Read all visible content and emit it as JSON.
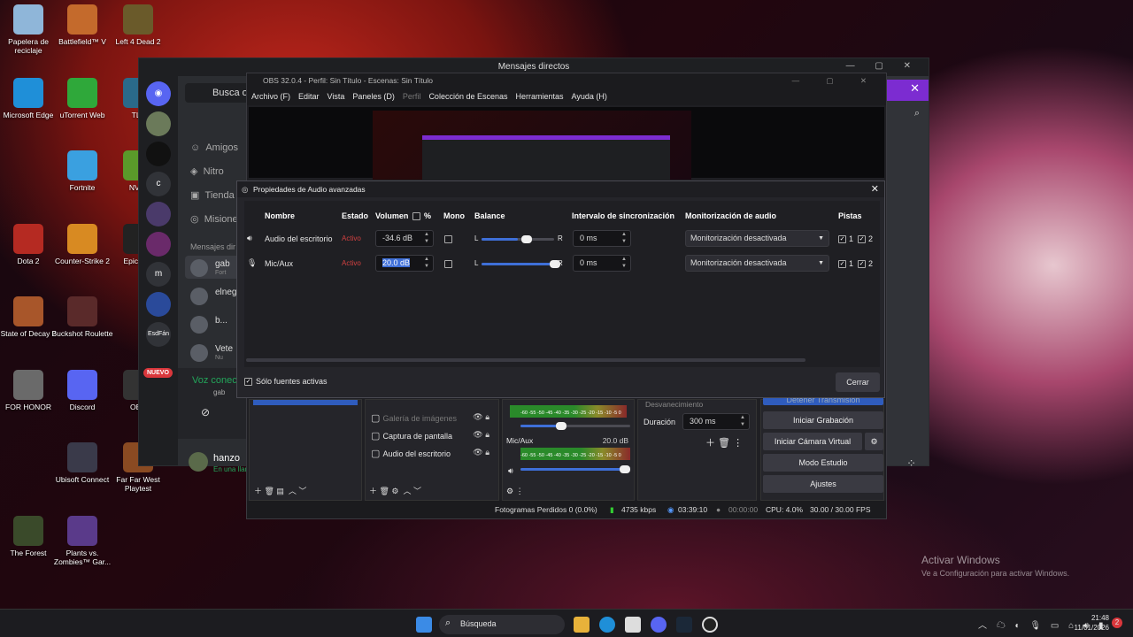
{
  "desktop_icons": [
    {
      "label": "Papelera de reciclaje",
      "color": "#8fb6d9"
    },
    {
      "label": "Battlefield™ V",
      "color": "#c46a2c"
    },
    {
      "label": "Left 4 Dead 2",
      "color": "#6a5a2a"
    },
    {
      "label": "Microsoft Edge",
      "color": "#1f8fd8"
    },
    {
      "label": "uTorrent Web",
      "color": "#2fa83a"
    },
    {
      "label": "Fortnite",
      "color": "#3aa0e0"
    },
    {
      "label": "Dota 2",
      "color": "#b52a22"
    },
    {
      "label": "Counter-Strike 2",
      "color": "#d88a22"
    },
    {
      "label": "State of Decay 2",
      "color": "#a8562a"
    },
    {
      "label": "Buckshot Roulette",
      "color": "#5a2a2a"
    },
    {
      "label": "FOR HONOR",
      "color": "#6a6a6a"
    },
    {
      "label": "Discord",
      "color": "#5865f2"
    },
    {
      "label": "Ubisoft Connect",
      "color": "#3a3a4a"
    },
    {
      "label": "Far Far West Playtest",
      "color": "#8a4a22"
    },
    {
      "label": "The Forest",
      "color": "#3a4a2a"
    },
    {
      "label": "Plants vs. Zombies™ Gar...",
      "color": "#5a3a8a"
    },
    {
      "label": "TLa",
      "color": "#2a6a8a"
    },
    {
      "label": "NVID",
      "color": "#5a9a2a"
    },
    {
      "label": "Epic Lau",
      "color": "#222"
    },
    {
      "label": "OBS",
      "color": "#333"
    }
  ],
  "discord": {
    "title": "Mensajes directos",
    "search": "Busca o i",
    "nav": [
      "Amigos",
      "Nitro",
      "Tienda",
      "Misiones"
    ],
    "dm_header": "Mensajes dir",
    "dms": [
      "gab",
      "elneg",
      "b...",
      "Vete"
    ],
    "dm_sub": [
      "Fort",
      "",
      "",
      "Nu"
    ],
    "rail": [
      "m",
      "c",
      "EsdFán"
    ],
    "nuevo": "NUEVO",
    "voice_status": "Voz conectada",
    "voice_sub": "gab",
    "user": "hanzo",
    "user_status": "En una llamada"
  },
  "obs": {
    "title": "OBS 32.0.4 - Perfil: Sin Título - Escenas: Sin Título",
    "menu": [
      "Archivo (F)",
      "Editar",
      "Vista",
      "Paneles (D)",
      "Perfil",
      "Colección de Escenas",
      "Herramientas",
      "Ayuda (H)"
    ],
    "sources": [
      "Galería de imágenes",
      "Captura de pantalla",
      "Audio del escritorio"
    ],
    "mixer_track": "Mic/Aux",
    "mixer_db": "20.0 dB",
    "meter_scale": "-60 -55 -50 -45 -40 -35 -30 -25 -20 -15 -10 -5 0",
    "transition_label": "Desvanecimiento",
    "duration_label": "Duración",
    "duration_value": "300 ms",
    "controls": [
      "Detener Transmisión",
      "Iniciar Grabación",
      "Iniciar Cámara Virtual",
      "Modo Estudio",
      "Ajustes"
    ],
    "status": {
      "frames": "Fotogramas Perdidos 0 (0.0%)",
      "kbps": "4735 kbps",
      "stream_time": "03:39:10",
      "rec_time": "00:00:00",
      "cpu": "CPU: 4.0%",
      "fps": "30.00 / 30.00 FPS"
    }
  },
  "dialog": {
    "title": "Propiedades de Audio avanzadas",
    "headers": {
      "name": "Nombre",
      "state": "Estado",
      "volume": "Volumen",
      "pct": "%",
      "mono": "Mono",
      "balance": "Balance",
      "sync": "Intervalo de sincronización",
      "monitor": "Monitorización de audio",
      "tracks": "Pistas"
    },
    "rows": [
      {
        "name": "Audio del escritorio",
        "state": "Activo",
        "volume": "-34.6 dB",
        "mono": false,
        "balance_l": "L",
        "balance_r": "R",
        "balance": 0.5,
        "sync": "0 ms",
        "monitor": "Monitorización desactivada",
        "t1": "1",
        "t2": "2"
      },
      {
        "name": "Mic/Aux",
        "state": "Activo",
        "volume": "20.0 dB",
        "mono": false,
        "balance_l": "L",
        "balance_r": "R",
        "balance": 0.95,
        "sync": "0 ms",
        "monitor": "Monitorización desactivada",
        "t1": "1",
        "t2": "2"
      }
    ],
    "only_active": "Sólo fuentes activas",
    "close": "Cerrar"
  },
  "watermark": {
    "line1": "Activar Windows",
    "line2": "Ve a Configuración para activar Windows."
  },
  "taskbar": {
    "search": "Búsqueda",
    "time": "21:48",
    "date": "11/01/2026",
    "badge": "2"
  }
}
